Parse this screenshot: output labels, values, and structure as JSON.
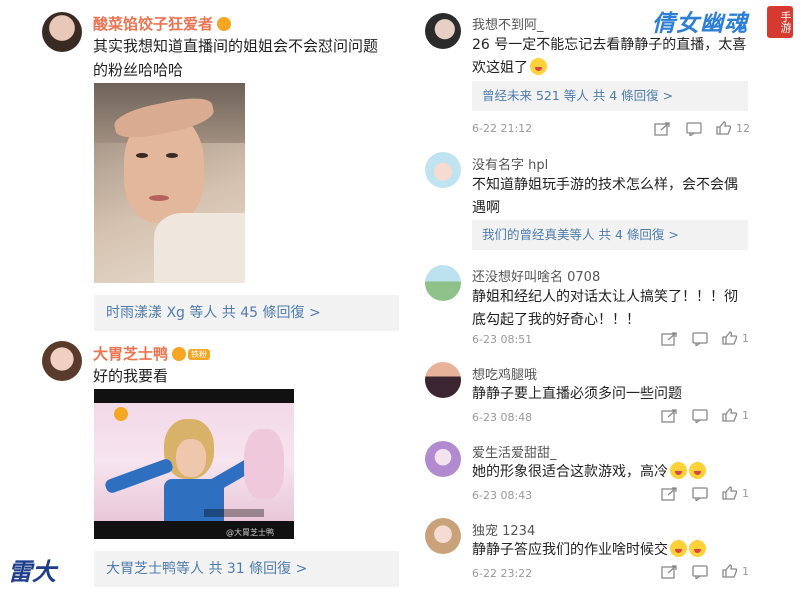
{
  "watermark": {
    "logo_text": "倩女幽魂",
    "logo_sub": "手游",
    "bottom_logo_text": "雷大"
  },
  "left": {
    "comment1": {
      "username": "酸菜馅饺子狂爱者",
      "text_line1": "其实我想知道直播间的姐姐会不会怼问问题",
      "text_line2": "的粉丝哈哈哈",
      "reply_bar": "时雨漾漾 Xg 等人 共 45 條回復 >"
    },
    "comment2": {
      "username": "大胃芝士鸭",
      "badge": "铁粉",
      "text": "好的我要看",
      "video_caption": "@大胃芝士鸭",
      "reply_bar": "大胃芝士鸭等人 共 31 條回復 >"
    }
  },
  "right": {
    "comments": [
      {
        "username": "我想不到阿_",
        "text_line1": "26 号一定不能忘记去看静静子的直播，太喜",
        "text_line2": "欢这姐了",
        "reply_bar": "曾经未来 521 等人 共 4 條回復 >",
        "time": "6-22 21:12",
        "likes": "12"
      },
      {
        "username": "没有名字 hpl",
        "text_line1": "不知道静姐玩手游的技术怎么样，会不会偶",
        "text_line2": "遇啊",
        "reply_bar": "我们的曾经真美等人 共 4 條回復 >",
        "time": "",
        "likes": ""
      },
      {
        "username": "还没想好叫啥名 0708",
        "text_line1": "静姐和经纪人的对话太让人搞笑了！！！彻",
        "text_line2": "底勾起了我的好奇心！！！",
        "reply_bar": "",
        "time": "6-23 08:51",
        "likes": "1"
      },
      {
        "username": "想吃鸡腿哦",
        "text_line1": "静静子要上直播必须多问一些问题",
        "text_line2": "",
        "reply_bar": "",
        "time": "6-23 08:48",
        "likes": "1"
      },
      {
        "username": "爱生活爱甜甜_",
        "text_line1": "她的形象很适合这款游戏，高冷",
        "text_line2": "",
        "reply_bar": "",
        "time": "6-23 08:43",
        "likes": "1"
      },
      {
        "username": "独宠 1234",
        "text_line1": "静静子答应我们的作业啥时候交",
        "text_line2": "",
        "reply_bar": "",
        "time": "6-22 23:22",
        "likes": "1"
      }
    ]
  }
}
